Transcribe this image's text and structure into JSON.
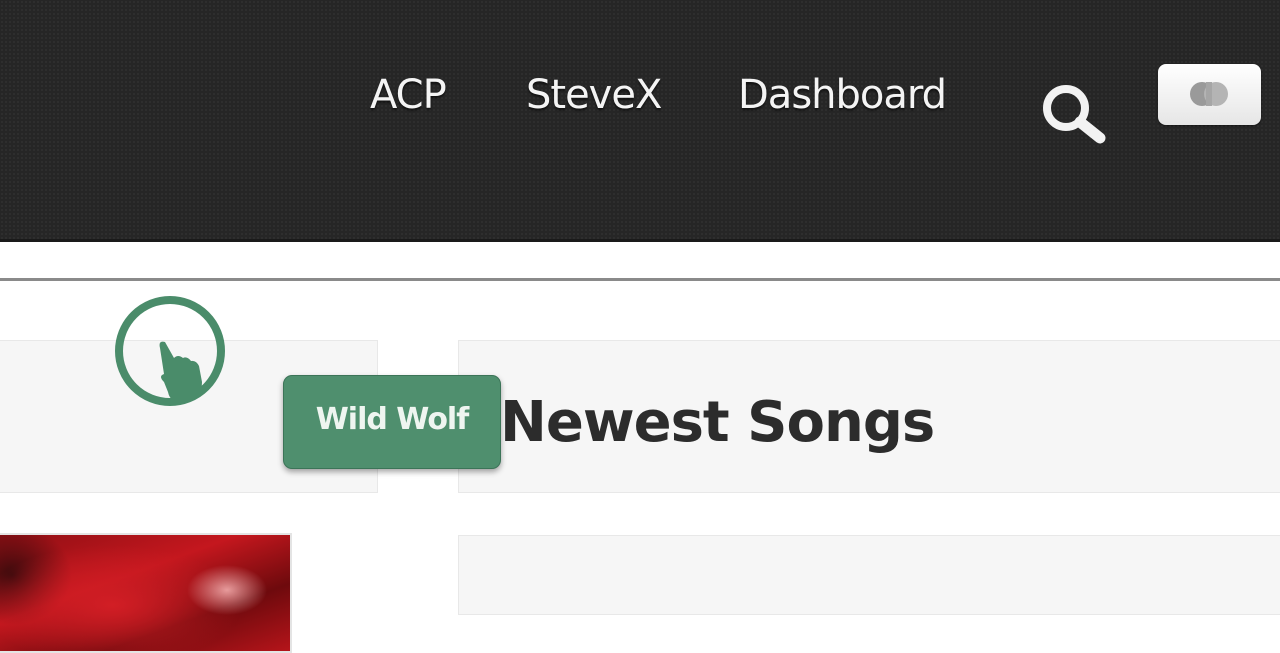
{
  "nav": {
    "acp_label": "ACP",
    "user_label": "SteveX",
    "dashboard_label": "Dashboard",
    "search_icon": "search-icon",
    "toggle_icon": "toggle-icon"
  },
  "tooltip": {
    "text": "Wild Wolf",
    "color": "#4f8f6e"
  },
  "cursor": {
    "icon": "hand-pointer-icon"
  },
  "main": {
    "section_title": "Newest Songs"
  },
  "colors": {
    "navbar_bg": "#262626",
    "accent_green": "#4f8f6e",
    "panel_bg": "#f6f6f6"
  }
}
